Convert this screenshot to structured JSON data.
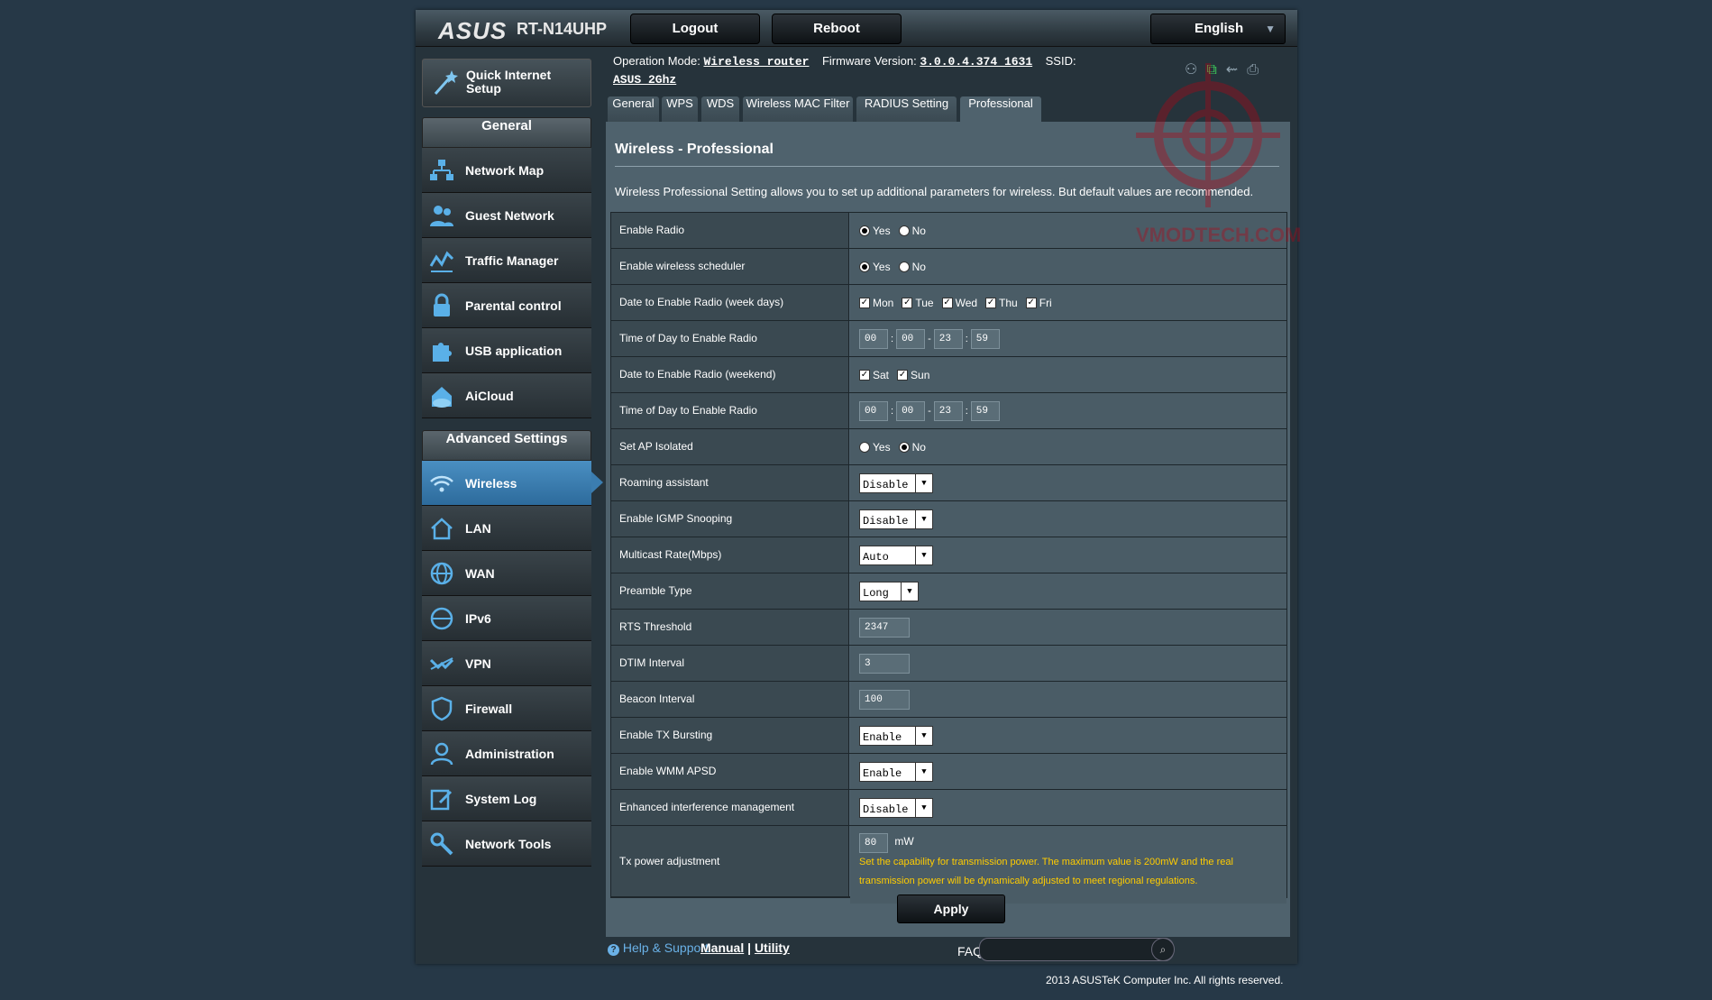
{
  "header": {
    "logo": "ASUS",
    "model": "RT-N14UHP",
    "logout_label": "Logout",
    "reboot_label": "Reboot",
    "language": "English"
  },
  "status": {
    "operation_mode_label": "Operation Mode:",
    "operation_mode_value": "Wireless router",
    "firmware_label": "Firmware Version:",
    "firmware_value": "3.0.0.4.374_1631",
    "ssid_label": "SSID:",
    "ssid_value": "ASUS_2Ghz"
  },
  "sidebar": {
    "quick_setup": "Quick Internet Setup",
    "general_title": "General",
    "general_items": [
      {
        "label": "Network Map"
      },
      {
        "label": "Guest Network"
      },
      {
        "label": "Traffic Manager"
      },
      {
        "label": "Parental control"
      },
      {
        "label": "USB application"
      },
      {
        "label": "AiCloud"
      }
    ],
    "advanced_title": "Advanced Settings",
    "advanced_items": [
      {
        "label": "Wireless"
      },
      {
        "label": "LAN"
      },
      {
        "label": "WAN"
      },
      {
        "label": "IPv6"
      },
      {
        "label": "VPN"
      },
      {
        "label": "Firewall"
      },
      {
        "label": "Administration"
      },
      {
        "label": "System Log"
      },
      {
        "label": "Network Tools"
      }
    ]
  },
  "tabs": [
    "General",
    "WPS",
    "WDS",
    "Wireless MAC Filter",
    "RADIUS Setting",
    "Professional"
  ],
  "page": {
    "title": "Wireless - Professional",
    "description": "Wireless Professional Setting allows you to set up additional parameters for wireless. But default values are recommended."
  },
  "options": {
    "yes": "Yes",
    "no": "No"
  },
  "days": {
    "mon": "Mon",
    "tue": "Tue",
    "wed": "Wed",
    "thu": "Thu",
    "fri": "Fri",
    "sat": "Sat",
    "sun": "Sun"
  },
  "settings": {
    "enable_radio": "Enable Radio",
    "enable_scheduler": "Enable wireless scheduler",
    "date_weekdays": "Date to Enable Radio (week days)",
    "time_weekdays": "Time of Day to Enable Radio",
    "weekday_time": {
      "h1": "00",
      "m1": "00",
      "h2": "23",
      "m2": "59"
    },
    "date_weekend": "Date to Enable Radio (weekend)",
    "time_weekend": "Time of Day to Enable Radio",
    "weekend_time": {
      "h1": "00",
      "m1": "00",
      "h2": "23",
      "m2": "59"
    },
    "ap_isolated": "Set AP Isolated",
    "roaming": "Roaming assistant",
    "roaming_value": "Disable",
    "igmp": "Enable IGMP Snooping",
    "igmp_value": "Disable",
    "multicast": "Multicast Rate(Mbps)",
    "multicast_value": "Auto",
    "preamble": "Preamble Type",
    "preamble_value": "Long",
    "rts": "RTS Threshold",
    "rts_value": "2347",
    "dtim": "DTIM Interval",
    "dtim_value": "3",
    "beacon": "Beacon Interval",
    "beacon_value": "100",
    "tx_bursting": "Enable TX Bursting",
    "tx_bursting_value": "Enable",
    "wmm_apsd": "Enable WMM APSD",
    "wmm_apsd_value": "Enable",
    "interference": "Enhanced interference management",
    "interference_value": "Disable",
    "tx_power": "Tx power adjustment",
    "tx_power_value": "80",
    "tx_power_unit": "mW",
    "tx_power_note": "Set the capability for transmission power. The maximum value is 200mW and the real transmission power will be dynamically adjusted to meet regional regulations."
  },
  "apply_label": "Apply",
  "footer": {
    "help": "Help & Support",
    "manual": "Manual",
    "separator": "|",
    "utility": "Utility",
    "faq": "FAQ",
    "copyright": "2013 ASUSTeK Computer Inc. All rights reserved."
  },
  "watermark": "VMODTECH.COM",
  "colors": {
    "accent": "#3b7db0",
    "warning": "#ffcc00",
    "panel": "#4f626d"
  }
}
